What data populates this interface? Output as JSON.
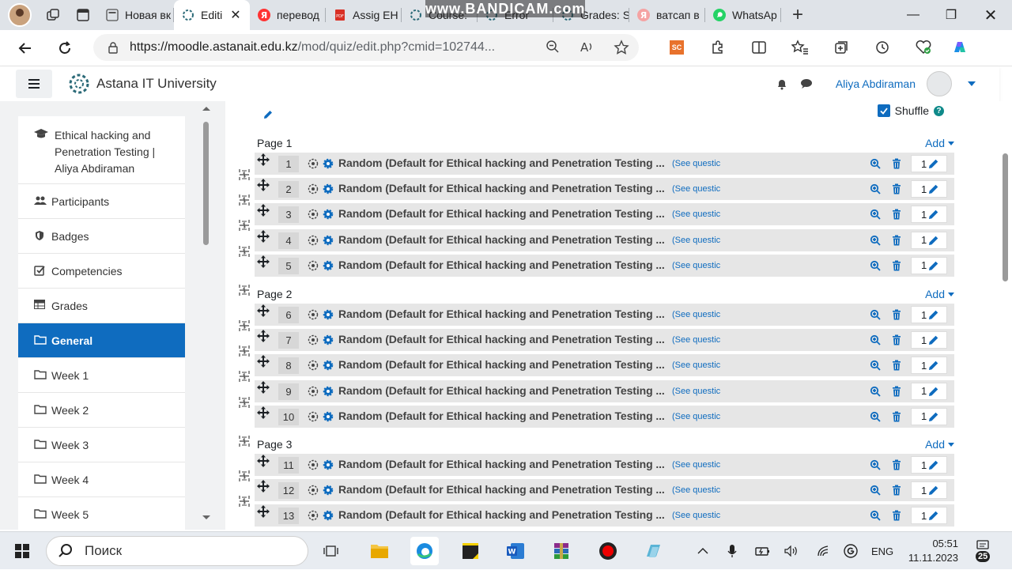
{
  "browser": {
    "tabs": [
      {
        "label": "Новая вк"
      },
      {
        "label": "Editi",
        "active": true
      },
      {
        "label": "перевод"
      },
      {
        "label": "Assig EH"
      },
      {
        "label": "Course:"
      },
      {
        "label": "Error"
      },
      {
        "label": "Grades: S"
      },
      {
        "label": "ватсап в"
      },
      {
        "label": "WhatsAp"
      }
    ],
    "watermark": "www.BANDICAM.com",
    "url_domain": "https://moodle.astanait.edu.kz",
    "url_path": "/mod/quiz/edit.php?cmid=102744...",
    "extension_badge": "SC"
  },
  "header": {
    "site_name": "Astana IT University",
    "user_name": "Aliya Abdiraman"
  },
  "drawer": {
    "course_title": "Ethical hacking and Penetration Testing | Aliya Abdiraman",
    "items": [
      {
        "label": "Participants",
        "icon": "users-icon"
      },
      {
        "label": "Badges",
        "icon": "shield-icon"
      },
      {
        "label": "Competencies",
        "icon": "checkbox-icon"
      },
      {
        "label": "Grades",
        "icon": "table-icon"
      },
      {
        "label": "General",
        "icon": "folder-icon",
        "active": true
      },
      {
        "label": "Week 1",
        "icon": "folder-icon"
      },
      {
        "label": "Week 2",
        "icon": "folder-icon"
      },
      {
        "label": "Week 3",
        "icon": "folder-icon"
      },
      {
        "label": "Week 4",
        "icon": "folder-icon"
      },
      {
        "label": "Week 5",
        "icon": "folder-icon"
      }
    ]
  },
  "quiz": {
    "shuffle_label": "Shuffle",
    "add_label": "Add",
    "pages": [
      {
        "label": "Page 1",
        "questions": [
          1,
          2,
          3,
          4,
          5
        ]
      },
      {
        "label": "Page 2",
        "questions": [
          6,
          7,
          8,
          9,
          10
        ]
      },
      {
        "label": "Page 3",
        "questions": [
          11,
          12,
          13
        ]
      }
    ],
    "question_title": "Random (Default for Ethical hacking and Penetration Testing ...",
    "see_questions": "(See questic",
    "mark": "1"
  },
  "taskbar": {
    "search_placeholder": "Поиск",
    "language": "ENG",
    "time": "05:51",
    "date": "11.11.2023",
    "notifications": "25"
  },
  "colors": {
    "accent": "#0f6cbf",
    "active_item": "#0f6cbf"
  }
}
